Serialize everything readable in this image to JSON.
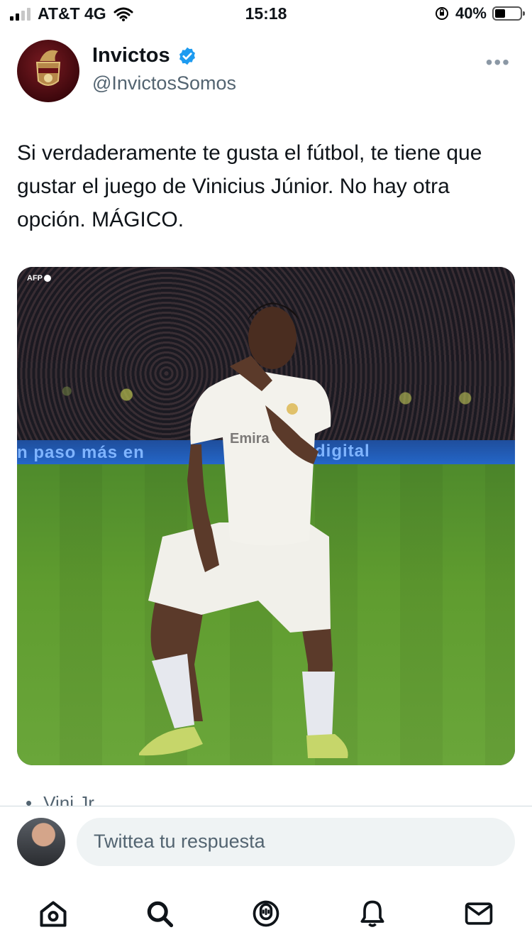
{
  "status_bar": {
    "carrier": "AT&T 4G",
    "time": "15:18",
    "battery": "40%",
    "battery_level": 0.4
  },
  "tweet": {
    "author_name": "Invictos",
    "author_handle": "@InvictosSomos",
    "verified": true,
    "text": "Si verdaderamente te gusta el fútbol, te tiene que gustar el juego de Vinicius Júnior. No hay otra opción. MÁGICO.",
    "more_icon": "more-icon",
    "media": {
      "watermark": "AFP",
      "board_text": "n paso más en",
      "board_text_2": "digital"
    },
    "topic": "Vini Jr."
  },
  "reply": {
    "placeholder": "Twittea tu respuesta"
  },
  "nav": {
    "items": [
      "home-icon",
      "search-icon",
      "spaces-icon",
      "notifications-icon",
      "messages-icon"
    ]
  },
  "colors": {
    "verified": "#1d9bf0",
    "secondary_text": "#536471",
    "input_bg": "#eff3f4"
  }
}
